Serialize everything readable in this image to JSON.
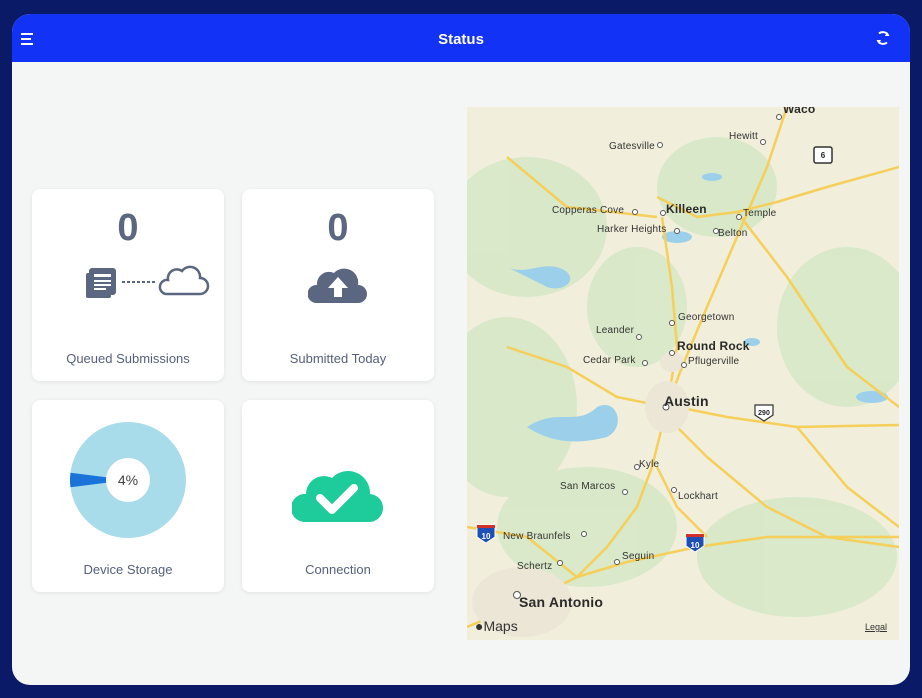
{
  "header": {
    "title": "Status",
    "menu_icon": "menu-icon",
    "refresh_icon": "refresh-icon"
  },
  "cards": {
    "queued": {
      "value": "0",
      "label": "Queued Submissions",
      "icons": [
        "documents-icon",
        "cloud-outline-icon"
      ]
    },
    "submitted": {
      "value": "0",
      "label": "Submitted Today",
      "icon": "cloud-upload-icon"
    },
    "storage": {
      "percent_text": "4%",
      "percent_value": 4,
      "label": "Device Storage"
    },
    "connection": {
      "label": "Connection",
      "icon": "cloud-check-icon",
      "color": "#1ecb9a"
    }
  },
  "colors": {
    "navbar": "#1232f5",
    "frame": "#0b1a66",
    "icon_gray": "#5b6680",
    "donut_light": "#a8dcea",
    "donut_used": "#1a73d9",
    "connection": "#1ecb9a"
  },
  "map": {
    "cities": [
      {
        "name": "Waco",
        "label": "Waco"
      },
      {
        "name": "Hewitt",
        "label": "Hewitt"
      },
      {
        "name": "Gatesville",
        "label": "Gatesville"
      },
      {
        "name": "Copperas Cove",
        "label": "Copperas Cove"
      },
      {
        "name": "Killeen",
        "label": "Killeen"
      },
      {
        "name": "Temple",
        "label": "Temple"
      },
      {
        "name": "Harker Heights",
        "label": "Harker Heights"
      },
      {
        "name": "Belton",
        "label": "Belton"
      },
      {
        "name": "Georgetown",
        "label": "Georgetown"
      },
      {
        "name": "Leander",
        "label": "Leander"
      },
      {
        "name": "Round Rock",
        "label": "Round Rock"
      },
      {
        "name": "Cedar Park",
        "label": "Cedar Park"
      },
      {
        "name": "Pflugerville",
        "label": "Pflugerville"
      },
      {
        "name": "Austin",
        "label": "Austin"
      },
      {
        "name": "Kyle",
        "label": "Kyle"
      },
      {
        "name": "San Marcos",
        "label": "San Marcos"
      },
      {
        "name": "Lockhart",
        "label": "Lockhart"
      },
      {
        "name": "New Braunfels",
        "label": "New Braunfels"
      },
      {
        "name": "Schertz",
        "label": "Schertz"
      },
      {
        "name": "Seguin",
        "label": "Seguin"
      },
      {
        "name": "San Antonio",
        "label": "San Antonio"
      }
    ],
    "shields": [
      "6",
      "290",
      "10",
      "10"
    ],
    "maps_logo": "Maps",
    "legal": "Legal"
  }
}
